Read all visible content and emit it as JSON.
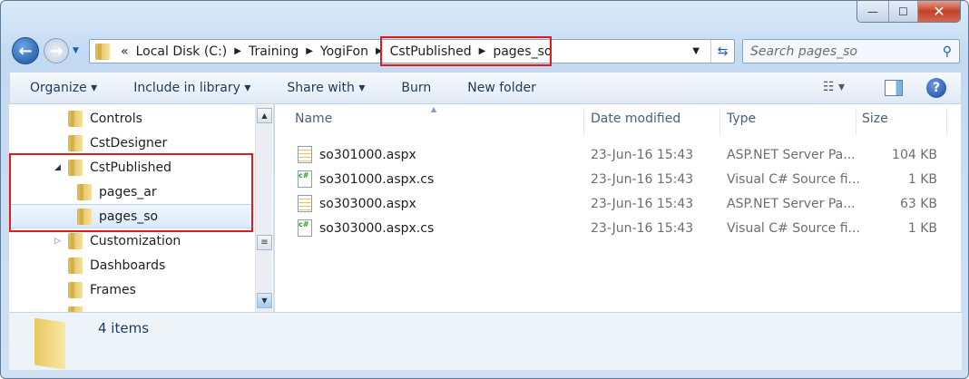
{
  "window": {
    "minimize": "—",
    "maximize": "☐",
    "close": "✕"
  },
  "address": {
    "overflow": "«",
    "crumbs": [
      "Local Disk (C:)",
      "Training",
      "YogiFon",
      "CstPublished",
      "pages_so"
    ]
  },
  "search": {
    "placeholder": "Search pages_so"
  },
  "toolbar": {
    "organize": "Organize ▾",
    "include": "Include in library ▾",
    "share": "Share with ▾",
    "burn": "Burn",
    "new_folder": "New folder"
  },
  "tree": [
    "Controls",
    "CstDesigner",
    "CstPublished",
    "pages_ar",
    "pages_so",
    "Customization",
    "Dashboards",
    "Frames"
  ],
  "columns": {
    "name": "Name",
    "date": "Date modified",
    "type": "Type",
    "size": "Size"
  },
  "files": [
    {
      "name": "so301000.aspx",
      "date": "23-Jun-16 15:43",
      "type": "ASP.NET Server Pa...",
      "size": "104 KB",
      "icon": "aspx"
    },
    {
      "name": "so301000.aspx.cs",
      "date": "23-Jun-16 15:43",
      "type": "Visual C# Source fi...",
      "size": "1 KB",
      "icon": "cs"
    },
    {
      "name": "so303000.aspx",
      "date": "23-Jun-16 15:43",
      "type": "ASP.NET Server Pa...",
      "size": "63 KB",
      "icon": "aspx"
    },
    {
      "name": "so303000.aspx.cs",
      "date": "23-Jun-16 15:43",
      "type": "Visual C# Source fi...",
      "size": "1 KB",
      "icon": "cs"
    }
  ],
  "status": {
    "count": "4 items"
  },
  "colors": {
    "highlight": "#e21a1a",
    "selection": "#dbeafc"
  }
}
